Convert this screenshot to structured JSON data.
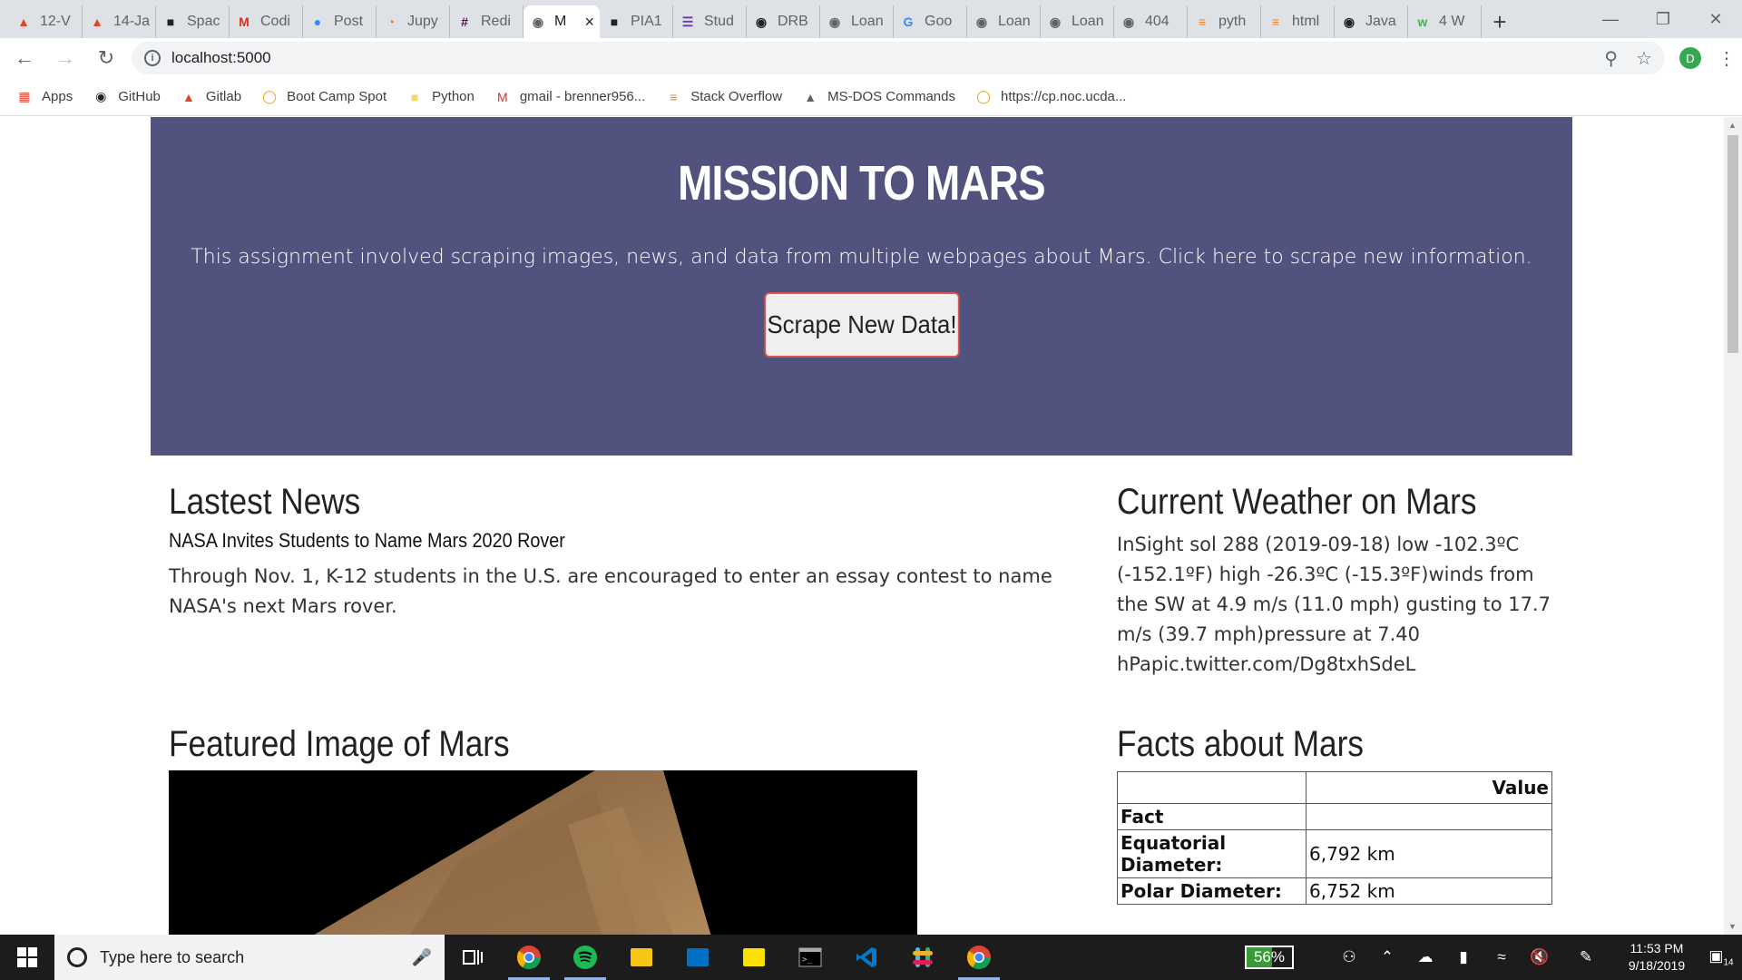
{
  "browser": {
    "tabs": [
      {
        "label": "12-V",
        "icon": "gitlab-icon",
        "color": "#e24329"
      },
      {
        "label": "14-Ja",
        "icon": "gitlab-icon",
        "color": "#e24329"
      },
      {
        "label": "Spac",
        "icon": "nasa-icon",
        "color": "#222222"
      },
      {
        "label": "Codi",
        "icon": "gmail-icon",
        "color": "#d93025"
      },
      {
        "label": "Post",
        "icon": "zoom-icon",
        "color": "#2d8cff"
      },
      {
        "label": "Jupy",
        "icon": "jupyter-icon",
        "color": "#f37626"
      },
      {
        "label": "Redi",
        "icon": "slack-icon",
        "color": "#4a154b"
      },
      {
        "label": "M",
        "icon": "globe-icon",
        "color": "#5f6368",
        "active": true
      },
      {
        "label": "PIA1",
        "icon": "nasa-icon",
        "color": "#222222"
      },
      {
        "label": "Stud",
        "icon": "forms-icon",
        "color": "#673ab7"
      },
      {
        "label": "DRB",
        "icon": "github-icon",
        "color": "#222222"
      },
      {
        "label": "Loan",
        "icon": "globe-icon",
        "color": "#5f6368"
      },
      {
        "label": "Goo",
        "icon": "google-icon",
        "color": "#4285f4"
      },
      {
        "label": "Loan",
        "icon": "globe-icon",
        "color": "#5f6368"
      },
      {
        "label": "Loan",
        "icon": "globe-icon",
        "color": "#5f6368"
      },
      {
        "label": "404",
        "icon": "globe-icon",
        "color": "#5f6368"
      },
      {
        "label": "pyth",
        "icon": "stackoverflow-icon",
        "color": "#f48024"
      },
      {
        "label": "html",
        "icon": "stackoverflow-icon",
        "color": "#f48024"
      },
      {
        "label": "Java",
        "icon": "github-icon",
        "color": "#222222"
      },
      {
        "label": "4 W",
        "icon": "w3schools-icon",
        "color": "#4caf50"
      }
    ],
    "url": "localhost:5000",
    "profile_initial": "D",
    "bookmarks": [
      {
        "label": "Apps",
        "icon": "apps-grid-icon",
        "color": "#ea4335"
      },
      {
        "label": "GitHub",
        "icon": "github-icon",
        "color": "#222222"
      },
      {
        "label": "Gitlab",
        "icon": "gitlab-icon",
        "color": "#e24329"
      },
      {
        "label": "Boot Camp Spot",
        "icon": "bootcamp-icon",
        "color": "#f59c00"
      },
      {
        "label": "Python",
        "icon": "folder-icon",
        "color": "#f5d76e"
      },
      {
        "label": "gmail - brenner956...",
        "icon": "gmail-icon",
        "color": "#d93025"
      },
      {
        "label": "Stack Overflow",
        "icon": "stackoverflow-icon",
        "color": "#f48024"
      },
      {
        "label": "MS-DOS Commands",
        "icon": "link-icon",
        "color": "#5f6368"
      },
      {
        "label": "https://cp.noc.ucda...",
        "icon": "bootcamp-icon",
        "color": "#f59c00"
      }
    ]
  },
  "page": {
    "jumbotron": {
      "title": "MISSION TO MARS",
      "description": "This assignment involved scraping images, news, and data from multiple webpages about Mars. Click here to scrape new information.",
      "button": "Scrape New Data!",
      "bg_color": "#52527e"
    },
    "news": {
      "heading": "Lastest News",
      "title": "NASA Invites Students to Name Mars 2020 Rover",
      "body": "Through Nov. 1, K-12 students in the U.S. are encouraged to enter an essay contest to name NASA's next Mars rover."
    },
    "weather": {
      "heading": "Current Weather on Mars",
      "text": "InSight sol 288 (2019-09-18) low -102.3ºC (-152.1ºF) high -26.3ºC (-15.3ºF)winds from the SW at 4.9 m/s (11.0 mph) gusting to 17.7 m/s (39.7 mph)pressure at 7.40 hPapic.twitter.com/Dg8txhSdeL"
    },
    "featured": {
      "heading": "Featured Image of Mars"
    },
    "facts": {
      "heading": "Facts about Mars",
      "value_header": "Value",
      "index_label": "Fact",
      "rows": [
        {
          "k": "Equatorial Diameter:",
          "v": "6,792 km"
        },
        {
          "k": "Polar Diameter:",
          "v": "6,752 km"
        }
      ]
    }
  },
  "taskbar": {
    "search_placeholder": "Type here to search",
    "battery": "56%",
    "battery_level": 0.56,
    "time": "11:53 PM",
    "date": "9/18/2019",
    "notifications": "14",
    "apps": [
      "chrome-icon",
      "spotify-icon",
      "file-explorer-icon",
      "outlook-icon",
      "sticky-notes-icon",
      "terminal-icon",
      "vscode-icon",
      "slack-icon",
      "chrome-icon"
    ]
  }
}
